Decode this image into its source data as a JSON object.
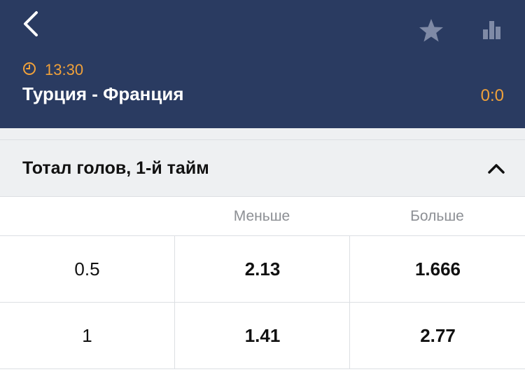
{
  "header": {
    "back_icon": "chevron-left-icon",
    "favorite_icon": "star-icon",
    "stats_icon": "bar-chart-icon",
    "time_icon": "clock-icon",
    "time": "13:30",
    "title": "Турция - Франция",
    "score": "0:0",
    "colors": {
      "background": "#2a3b61",
      "accent": "#f0a13a",
      "icon_muted": "#7f8aa6"
    }
  },
  "market": {
    "title": "Тотал голов, 1-й тайм",
    "toggle_icon": "chevron-up-icon",
    "expanded": true,
    "columns": [
      "",
      "Меньше",
      "Больше"
    ],
    "rows": [
      {
        "line": "0.5",
        "under": "2.13",
        "over": "1.666"
      },
      {
        "line": "1",
        "under": "1.41",
        "over": "2.77"
      }
    ]
  }
}
